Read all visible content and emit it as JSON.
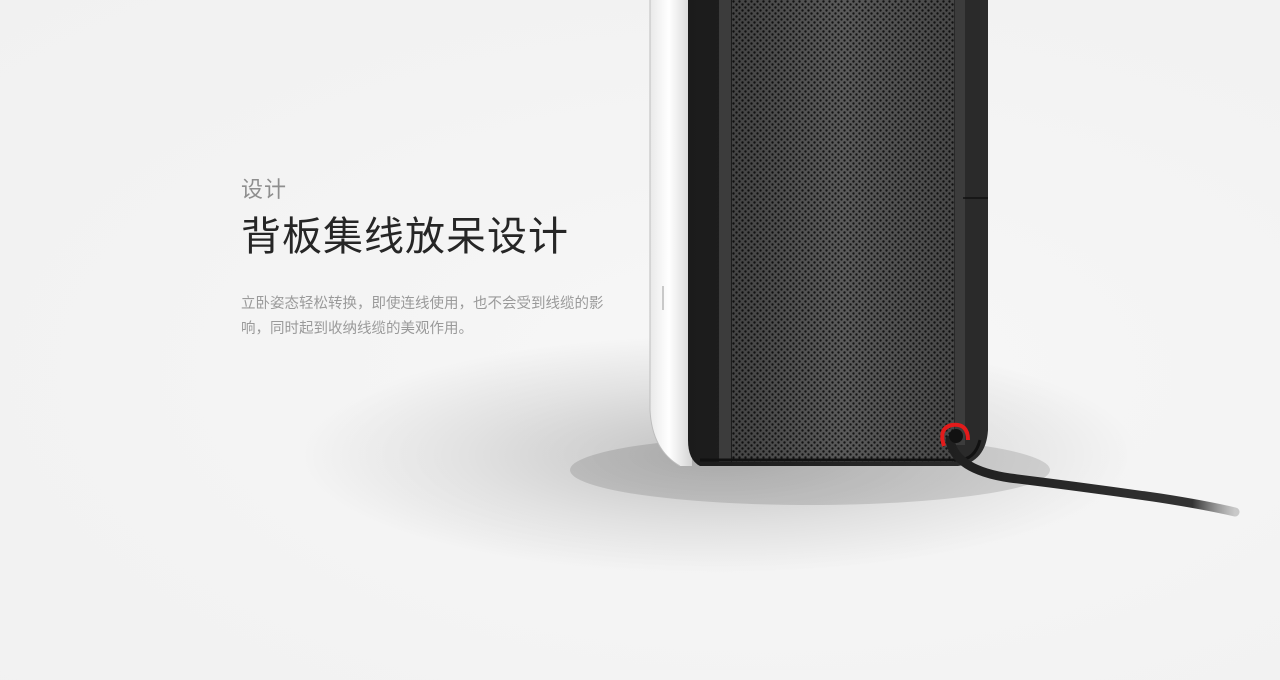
{
  "hero": {
    "eyebrow": "设计",
    "headline": "背板集线放呆设计",
    "description": "立卧姿态轻松转换，即使连线使用，也不会受到线缆的影响，同时起到收纳线缆的美观作用。"
  },
  "image": {
    "subject": "speaker-rear-cable-management",
    "colors": {
      "body": "#1e1e1e",
      "grille": "#3a3a3a",
      "cable": "#2a2a2a",
      "accent": "#e31b1b",
      "background": "#f4f4f4"
    }
  }
}
